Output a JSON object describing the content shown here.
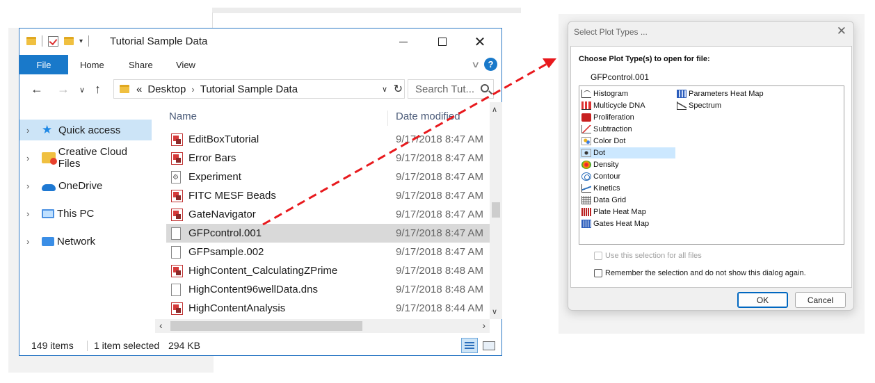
{
  "explorer": {
    "window_title": "Tutorial Sample Data",
    "controls": {
      "minimize": "",
      "maximize": "",
      "close": "✕"
    },
    "ribbon": {
      "file": "File",
      "home": "Home",
      "share": "Share",
      "view": "View",
      "help": "?"
    },
    "address": {
      "overflow": "«",
      "crumbs": [
        "Desktop",
        "Tutorial Sample Data"
      ],
      "search_placeholder": "Search Tut..."
    },
    "nav_items": [
      {
        "label": "Quick access",
        "icon": "star-icon",
        "selected": true
      },
      {
        "label": "Creative Cloud Files",
        "icon": "creative-cloud-folder-icon"
      },
      {
        "label": "OneDrive",
        "icon": "cloud-icon"
      },
      {
        "label": "This PC",
        "icon": "pc-icon"
      },
      {
        "label": "Network",
        "icon": "network-icon"
      }
    ],
    "columns": {
      "name": "Name",
      "date": "Date modified"
    },
    "files": [
      {
        "name": "EditBoxTutorial",
        "date": "9/17/2018 8:47 AM",
        "icon": "app-icon"
      },
      {
        "name": "Error Bars",
        "date": "9/17/2018 8:47 AM",
        "icon": "app-icon"
      },
      {
        "name": "Experiment",
        "date": "9/17/2018 8:47 AM",
        "icon": "gear-doc-icon"
      },
      {
        "name": "FITC MESF Beads",
        "date": "9/17/2018 8:47 AM",
        "icon": "app-icon"
      },
      {
        "name": "GateNavigator",
        "date": "9/17/2018 8:47 AM",
        "icon": "app-icon"
      },
      {
        "name": "GFPcontrol.001",
        "date": "9/17/2018 8:47 AM",
        "icon": "doc-icon",
        "selected": true
      },
      {
        "name": "GFPsample.002",
        "date": "9/17/2018 8:47 AM",
        "icon": "doc-icon"
      },
      {
        "name": "HighContent_CalculatingZPrime",
        "date": "9/17/2018 8:48 AM",
        "icon": "app-icon"
      },
      {
        "name": "HighContent96wellData.dns",
        "date": "9/17/2018 8:48 AM",
        "icon": "doc-icon"
      },
      {
        "name": "HighContentAnalysis",
        "date": "9/17/2018 8:44 AM",
        "icon": "app-icon"
      }
    ],
    "status": {
      "count": "149 items",
      "selected": "1 item selected",
      "size": "294 KB"
    }
  },
  "dialog": {
    "title": "Select Plot Types ...",
    "close": "✕",
    "heading": "Choose Plot Type(s) to open for file:",
    "file": "GFPcontrol.001",
    "plot_types_col1": [
      {
        "label": "Histogram",
        "icon": "histogram-icon"
      },
      {
        "label": "Multicycle DNA",
        "icon": "multicycle-dna-icon"
      },
      {
        "label": "Proliferation",
        "icon": "proliferation-icon"
      },
      {
        "label": "Subtraction",
        "icon": "subtraction-icon"
      },
      {
        "label": "Color Dot",
        "icon": "color-dot-icon"
      },
      {
        "label": "Dot",
        "icon": "dot-icon",
        "selected": true
      },
      {
        "label": "Density",
        "icon": "density-icon"
      },
      {
        "label": "Contour",
        "icon": "contour-icon"
      },
      {
        "label": "Kinetics",
        "icon": "kinetics-icon"
      },
      {
        "label": "Data Grid",
        "icon": "data-grid-icon"
      },
      {
        "label": "Plate Heat Map",
        "icon": "plate-heat-map-icon"
      },
      {
        "label": "Gates Heat Map",
        "icon": "gates-heat-map-icon"
      }
    ],
    "plot_types_col2": [
      {
        "label": "Parameters Heat Map",
        "icon": "parameters-heat-map-icon"
      },
      {
        "label": "Spectrum",
        "icon": "spectrum-icon"
      }
    ],
    "use_all_label": "Use this selection for all files",
    "remember_label": "Remember the selection and do not show this dialog again.",
    "ok": "OK",
    "cancel": "Cancel"
  }
}
